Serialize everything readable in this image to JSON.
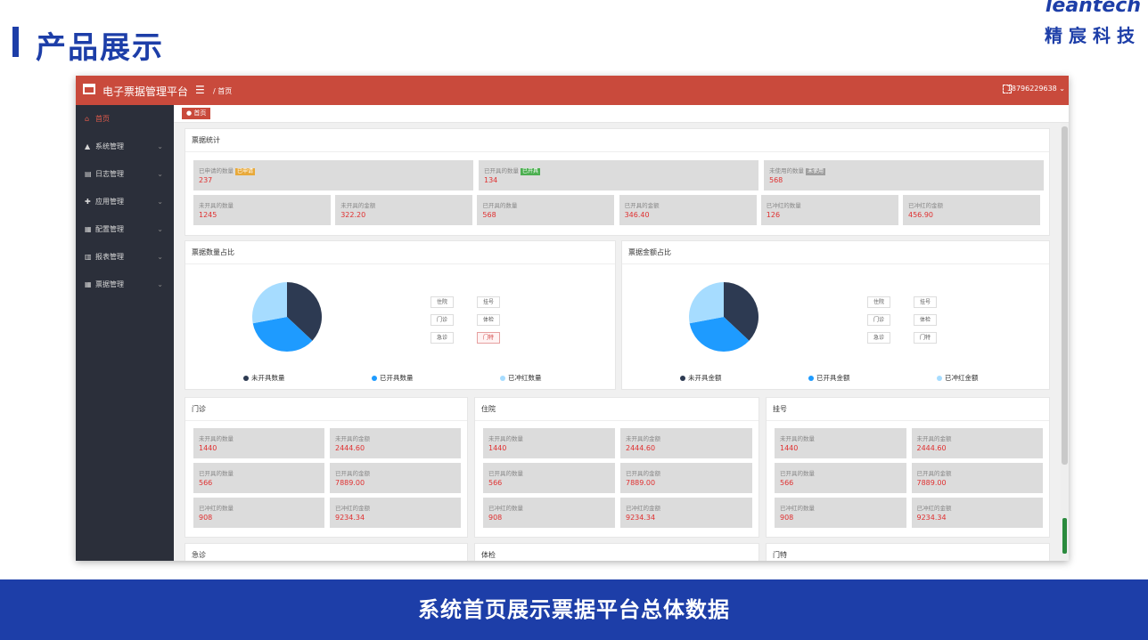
{
  "slide": {
    "title": "产品展示",
    "logo_en": "leantech",
    "logo_cn": "精宸科技",
    "banner": "系统首页展示票据平台总体数据"
  },
  "app": {
    "name": "电子票据管理平台",
    "menu_icon": "☰",
    "breadcrumb": "/ 首页",
    "user": "18796229638 ⌄",
    "tab": "● 首页"
  },
  "sidebar": {
    "items": [
      {
        "icon": "⌂",
        "label": "首页"
      },
      {
        "icon": "▲",
        "label": "系统管理"
      },
      {
        "icon": "▤",
        "label": "日志管理"
      },
      {
        "icon": "✚",
        "label": "应用管理"
      },
      {
        "icon": "▦",
        "label": "配置管理"
      },
      {
        "icon": "▥",
        "label": "报表管理"
      },
      {
        "icon": "▦",
        "label": "票据管理"
      }
    ]
  },
  "stats": {
    "title": "票据统计",
    "row1": [
      {
        "label": "已申请的数量",
        "badge": "已申请",
        "badge_color": "#e8a93a",
        "value": "237"
      },
      {
        "label": "已开具的数量",
        "badge": "已开具",
        "badge_color": "#4caf50",
        "value": "134"
      },
      {
        "label": "未使用的数量",
        "badge": "未使用",
        "badge_color": "#9e9e9e",
        "value": "568"
      }
    ],
    "row2": [
      {
        "label": "未开具的数量",
        "value": "1245"
      },
      {
        "label": "未开具的金额",
        "value": "322.20"
      },
      {
        "label": "已开具的数量",
        "value": "568"
      },
      {
        "label": "已开具的金额",
        "value": "346.40"
      },
      {
        "label": "已冲红的数量",
        "value": "126"
      },
      {
        "label": "已冲红的金额",
        "value": "456.90"
      }
    ]
  },
  "pies": [
    {
      "title": "票据数量占比",
      "legend": [
        "未开具数量",
        "已开具数量",
        "已冲红数量"
      ],
      "depts": [
        "住院",
        "挂号",
        "门诊",
        "体检",
        "急诊",
        "门特"
      ],
      "selected": 5
    },
    {
      "title": "票据金额占比",
      "legend": [
        "未开具金额",
        "已开具金额",
        "已冲红金额"
      ],
      "depts": [
        "住院",
        "挂号",
        "门诊",
        "体检",
        "急诊",
        "门特"
      ],
      "selected": -1
    }
  ],
  "chart_data": [
    {
      "type": "pie",
      "categories": [
        "未开具数量",
        "已开具数量",
        "已冲红数量"
      ],
      "values": [
        37,
        35,
        28
      ],
      "colors": [
        "#2d3a52",
        "#1e9bff",
        "#a6dcff"
      ]
    },
    {
      "type": "pie",
      "categories": [
        "未开具金额",
        "已开具金额",
        "已冲红金额"
      ],
      "values": [
        37,
        35,
        28
      ],
      "colors": [
        "#2d3a52",
        "#1e9bff",
        "#a6dcff"
      ]
    }
  ],
  "departments": [
    {
      "title": "门诊",
      "stats": [
        {
          "label": "未开具的数量",
          "value": "1440"
        },
        {
          "label": "未开具的金额",
          "value": "2444.60"
        },
        {
          "label": "已开具的数量",
          "value": "566"
        },
        {
          "label": "已开具的金额",
          "value": "7889.00"
        },
        {
          "label": "已冲红的数量",
          "value": "908"
        },
        {
          "label": "已冲红的金额",
          "value": "9234.34"
        }
      ]
    },
    {
      "title": "住院",
      "stats": [
        {
          "label": "未开具的数量",
          "value": "1440"
        },
        {
          "label": "未开具的金额",
          "value": "2444.60"
        },
        {
          "label": "已开具的数量",
          "value": "566"
        },
        {
          "label": "已开具的金额",
          "value": "7889.00"
        },
        {
          "label": "已冲红的数量",
          "value": "908"
        },
        {
          "label": "已冲红的金额",
          "value": "9234.34"
        }
      ]
    },
    {
      "title": "挂号",
      "stats": [
        {
          "label": "未开具的数量",
          "value": "1440"
        },
        {
          "label": "未开具的金额",
          "value": "2444.60"
        },
        {
          "label": "已开具的数量",
          "value": "566"
        },
        {
          "label": "已开具的金额",
          "value": "7889.00"
        },
        {
          "label": "已冲红的数量",
          "value": "908"
        },
        {
          "label": "已冲红的金额",
          "value": "9234.34"
        }
      ]
    }
  ],
  "lower_cards": [
    "急诊",
    "体检",
    "门特"
  ]
}
